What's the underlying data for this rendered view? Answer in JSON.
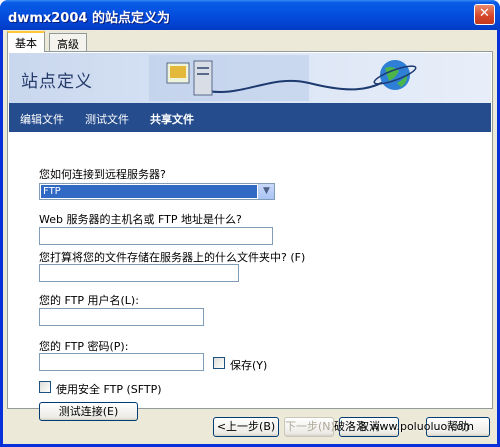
{
  "window": {
    "title": "dwmx2004 的站点定义为",
    "close_glyph": "✕"
  },
  "tabs": [
    {
      "label": "基本",
      "active": true
    },
    {
      "label": "高级",
      "active": false
    }
  ],
  "banner": {
    "title": "站点定义"
  },
  "nav": [
    {
      "label": "编辑文件",
      "active": false
    },
    {
      "label": "测试文件",
      "active": false
    },
    {
      "label": "共享文件",
      "active": true
    }
  ],
  "form": {
    "connect_question": "您如何连接到远程服务器?",
    "connect_value": "FTP",
    "host_question": "Web 服务器的主机名或 FTP 地址是什么?",
    "host_value": "",
    "folder_question": "您打算将您的文件存储在服务器上的什么文件夹中? (F)",
    "folder_value": "",
    "user_label": "您的 FTP 用户名(L):",
    "user_value": "",
    "password_label": "您的 FTP 密码(P):",
    "password_value": "",
    "save_label": "保存(Y)",
    "sftp_label": "使用安全 FTP (SFTP)",
    "test_button": "测试连接(E)"
  },
  "footer": {
    "back": "<上一步(B)",
    "next": "下一步(N)",
    "cancel": "取消",
    "help": "帮助"
  },
  "watermark": "破洛洛 www.poluoluo.com"
}
